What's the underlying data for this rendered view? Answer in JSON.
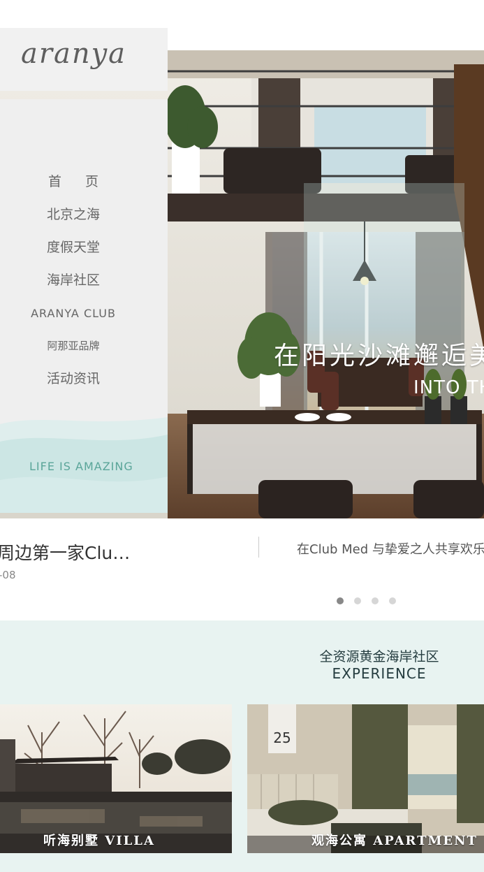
{
  "brand": {
    "logo_text": "aranya"
  },
  "menu": {
    "items": [
      {
        "label": "首页"
      },
      {
        "label": "北京之海"
      },
      {
        "label": "度假天堂"
      },
      {
        "label": "海岸社区"
      },
      {
        "label": "ARANYA CLUB"
      },
      {
        "label": "阿那亚品牌"
      },
      {
        "label": "活动资讯"
      }
    ],
    "tagline": "LIFE IS AMAZING"
  },
  "hero": {
    "caption": "在阳光沙滩邂逅美",
    "sub_caption": "INTO TH"
  },
  "news": {
    "current_title": "周边第一家Clu…",
    "current_date": "-08",
    "next_title": "在Club Med 与挚爱之人共享欢乐",
    "slide_count": 4,
    "active_slide": 1
  },
  "feature": {
    "title_cn": "全资源黄金海岸社区",
    "title_en": "EXPERIENCE",
    "cards": [
      {
        "label": "听海别墅 VILLA"
      },
      {
        "label": "观海公寓 APARTMENT"
      }
    ]
  },
  "colors": {
    "menu_bg": "#efefef",
    "tagline": "#5aa599",
    "feature_bg": "#e8f3f1",
    "active_dot": "#888888",
    "inactive_dot": "#d6d6d6"
  }
}
